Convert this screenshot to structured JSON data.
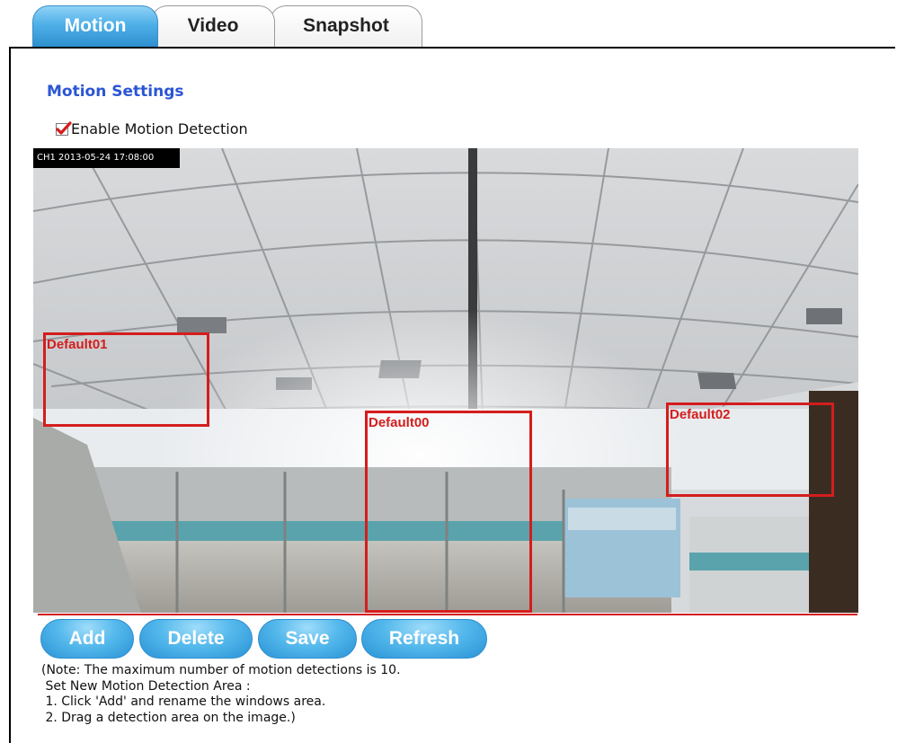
{
  "tabs": [
    {
      "label": "Motion",
      "active": true
    },
    {
      "label": "Video",
      "active": false
    },
    {
      "label": "Snapshot",
      "active": false
    }
  ],
  "settings": {
    "title": "Motion Settings",
    "enable_label": "Enable Motion Detection",
    "enable_checked": true
  },
  "camera": {
    "timestamp": "CH1 2013-05-24 17:08:00",
    "zones": [
      {
        "name": "Default00"
      },
      {
        "name": "Default01"
      },
      {
        "name": "Default02"
      }
    ]
  },
  "buttons": {
    "add": "Add",
    "delete": "Delete",
    "save": "Save",
    "refresh": "Refresh"
  },
  "notes": [
    "(Note: The maximum number of motion detections is 10.",
    " Set New Motion Detection Area :",
    " 1. Click 'Add' and rename the windows area.",
    " 2. Drag a detection area on the image.)"
  ],
  "colors": {
    "accent": "#2b55d4",
    "zone_border": "#d41d1d",
    "tab_active": "#4fb0e8",
    "checkbox_check": "#d41d1d"
  }
}
